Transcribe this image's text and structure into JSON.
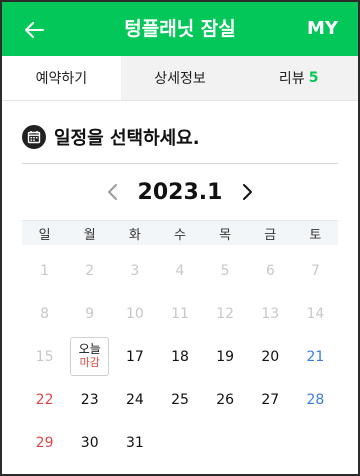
{
  "header": {
    "title": "텅플래닛 잠실",
    "my_label": "MY"
  },
  "tabs": [
    {
      "label": "예약하기",
      "active": true
    },
    {
      "label": "상세정보"
    },
    {
      "label": "리뷰",
      "count": "5"
    }
  ],
  "section": {
    "title": "일정을 선택하세요."
  },
  "calendar": {
    "month_label": "2023.1",
    "weekdays": [
      "일",
      "월",
      "화",
      "수",
      "목",
      "금",
      "토"
    ],
    "today": {
      "label": "오늘",
      "status": "마감"
    },
    "weeks": [
      [
        "1",
        "2",
        "3",
        "4",
        "5",
        "6",
        "7"
      ],
      [
        "8",
        "9",
        "10",
        "11",
        "12",
        "13",
        "14"
      ],
      [
        "15",
        "",
        "17",
        "18",
        "19",
        "20",
        "21"
      ],
      [
        "22",
        "23",
        "24",
        "25",
        "26",
        "27",
        "28"
      ],
      [
        "29",
        "30",
        "31",
        "",
        "",
        "",
        ""
      ]
    ]
  },
  "colors": {
    "brand": "#04c75a",
    "sunday": "#e34848",
    "saturday": "#3b7ee0",
    "disabled": "#c8c8c8"
  }
}
